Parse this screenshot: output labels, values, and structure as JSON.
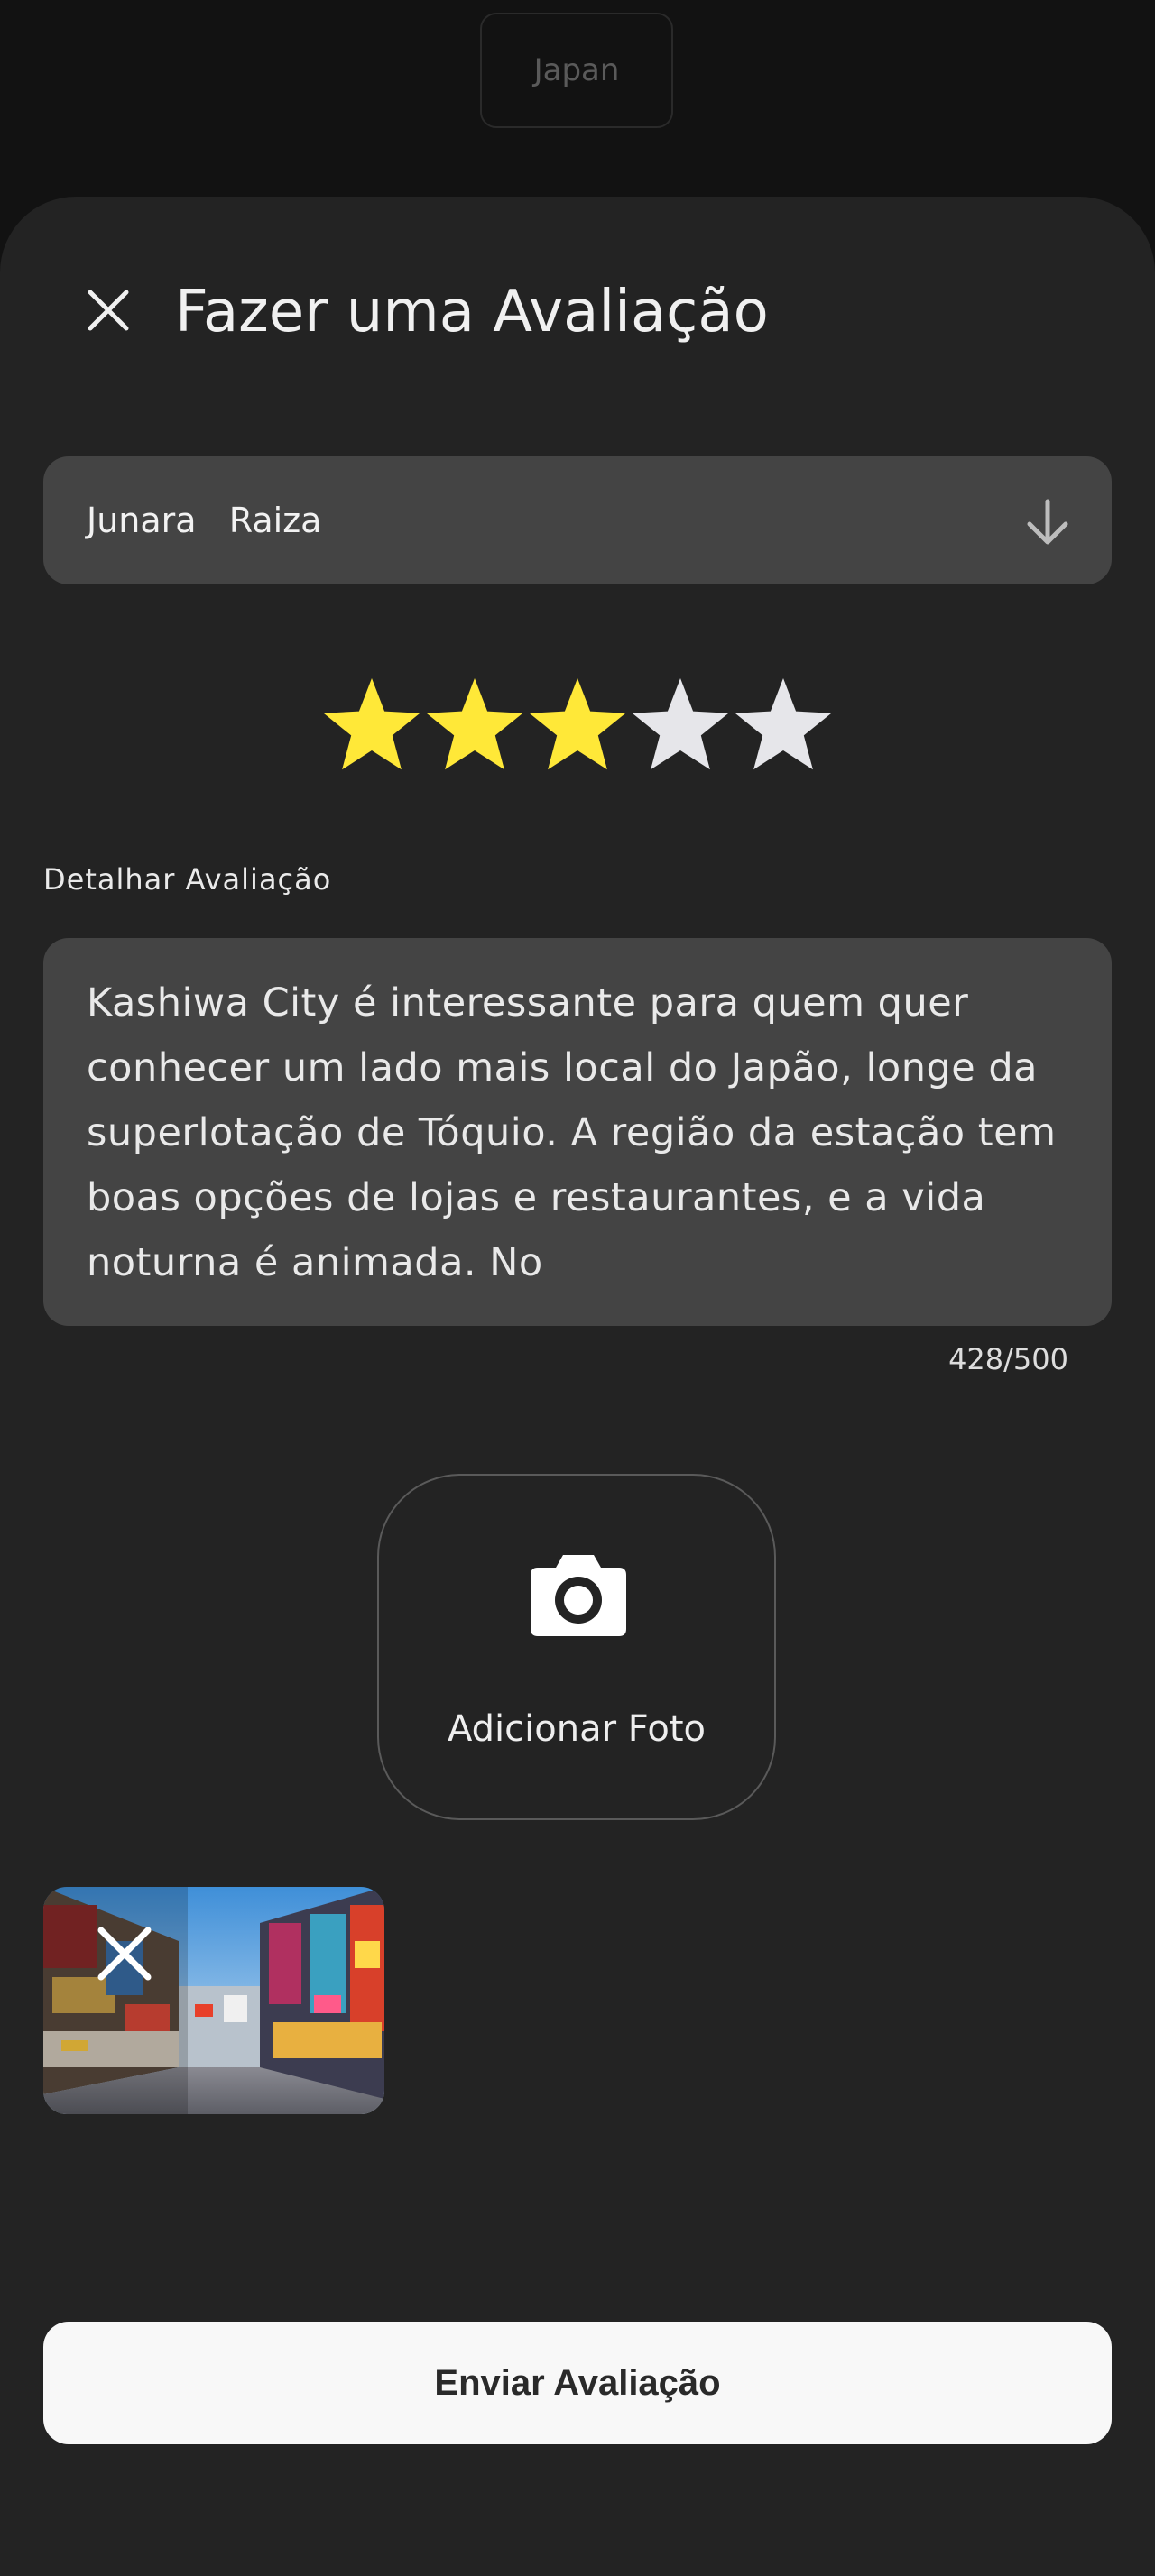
{
  "background": {
    "chip_label": "Japan"
  },
  "dialog": {
    "title": "Fazer uma Avaliação",
    "close_icon": "close-icon"
  },
  "user_select": {
    "value": "Junara   Raiza",
    "icon": "arrow-down-icon"
  },
  "rating": {
    "value": 3,
    "max": 5,
    "filled_color": "#FFE838",
    "empty_color": "#E6E6EA"
  },
  "review": {
    "label": "Detalhar Avaliação",
    "text": "Kashiwa City é interessante para quem quer conhecer um lado mais local do Japão, longe da superlotação de Tóquio. A região da estação tem boas opções de lojas e restaurantes, e a vida noturna é animada. No",
    "counter": "428/500"
  },
  "add_photo": {
    "label": "Adicionar Foto",
    "icon": "camera-icon"
  },
  "attached_photo": {
    "remove_icon": "close-icon"
  },
  "submit": {
    "label": "Enviar Avaliação"
  }
}
